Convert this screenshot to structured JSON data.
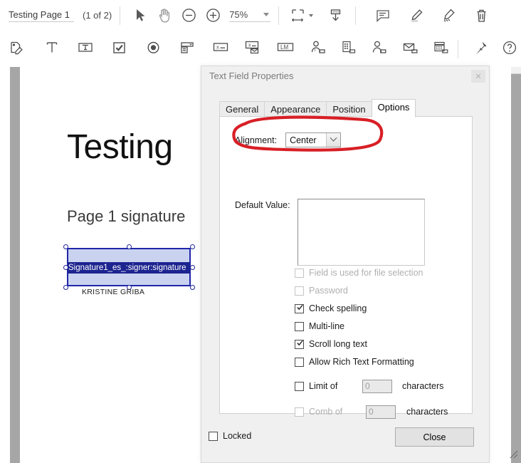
{
  "toolbar": {
    "page_label": "Testing Page 1",
    "page_count": "(1 of 2)",
    "zoom_level": "75%",
    "tools": [
      {
        "name": "select-tool",
        "icon": "cursor-arrow-icon"
      },
      {
        "name": "hand-tool",
        "icon": "hand-icon"
      },
      {
        "name": "zoom-out",
        "icon": "minus-circle-icon"
      },
      {
        "name": "zoom-in",
        "icon": "plus-circle-icon"
      },
      {
        "name": "fit-page",
        "icon": "fit-width-icon"
      },
      {
        "name": "download",
        "icon": "download-icon"
      },
      {
        "name": "comment",
        "icon": "comment-icon"
      },
      {
        "name": "highlight",
        "icon": "highlighter-icon"
      },
      {
        "name": "draw",
        "icon": "pen-icon"
      },
      {
        "name": "delete",
        "icon": "trash-icon"
      }
    ],
    "form_tools": [
      {
        "name": "add-signature-field",
        "icon": "signature-field-icon"
      },
      {
        "name": "add-text",
        "icon": "text-tool-icon"
      },
      {
        "name": "add-text-field",
        "icon": "text-field-icon"
      },
      {
        "name": "add-checkbox",
        "icon": "checkbox-icon"
      },
      {
        "name": "add-radio-button",
        "icon": "radio-button-icon"
      },
      {
        "name": "add-dropdown",
        "icon": "dropdown-icon"
      },
      {
        "name": "add-initials",
        "icon": "initials-field-icon"
      },
      {
        "name": "add-stamp",
        "icon": "stamp-field-icon"
      },
      {
        "name": "add-list-box",
        "icon": "list-box-icon"
      },
      {
        "name": "add-title-field",
        "icon": "title-field-icon"
      },
      {
        "name": "add-company-field",
        "icon": "company-field-icon"
      },
      {
        "name": "add-name-field",
        "icon": "name-field-icon"
      },
      {
        "name": "add-email-field",
        "icon": "email-field-icon"
      },
      {
        "name": "add-date-field",
        "icon": "date-field-icon"
      },
      {
        "name": "pin",
        "icon": "pin-icon"
      },
      {
        "name": "help",
        "icon": "help-icon"
      }
    ]
  },
  "document": {
    "heading": "Testing",
    "subheading": "Page 1 signature",
    "field_text": "Signature1_es_:signer:signature",
    "field_caption": "KRISTINE GRIBA"
  },
  "dialog": {
    "title": "Text Field Properties",
    "tabs": [
      {
        "label": "General",
        "active": false
      },
      {
        "label": "Appearance",
        "active": false
      },
      {
        "label": "Position",
        "active": false
      },
      {
        "label": "Options",
        "active": true
      }
    ],
    "alignment_label": "Alignment:",
    "alignment_value": "Center",
    "default_value_label": "Default Value:",
    "default_value": "",
    "checkboxes": [
      {
        "label": "Field is used for file selection",
        "checked": false,
        "disabled": true
      },
      {
        "label": "Password",
        "checked": false,
        "disabled": true
      },
      {
        "label": "Check spelling",
        "checked": true,
        "disabled": false
      },
      {
        "label": "Multi-line",
        "checked": false,
        "disabled": false
      },
      {
        "label": "Scroll long text",
        "checked": true,
        "disabled": false
      },
      {
        "label": "Allow Rich Text Formatting",
        "checked": false,
        "disabled": false
      }
    ],
    "limit_label": "Limit of",
    "limit_value": "0",
    "limit_suffix": "characters",
    "comb_label": "Comb of",
    "comb_value": "0",
    "comb_suffix": "characters",
    "locked_label": "Locked",
    "locked_checked": false,
    "close_label": "Close"
  },
  "annotation": {
    "shape": "hand-drawn-ellipse",
    "color": "#d81f26",
    "target": "alignment-row"
  }
}
